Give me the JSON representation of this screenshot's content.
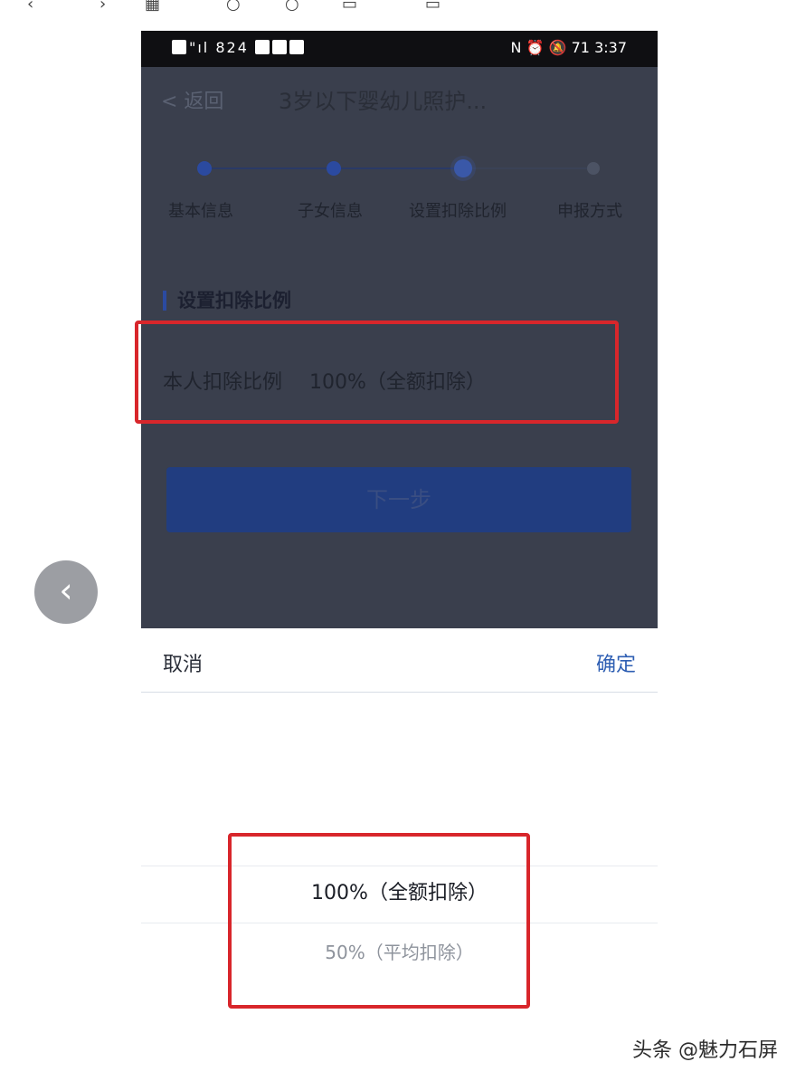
{
  "status_bar": {
    "left_text": "\"ıl 824",
    "time": "3:37",
    "battery": "71"
  },
  "header": {
    "back_label": "< 返回",
    "title": "3岁以下婴幼儿照护..."
  },
  "steps": [
    {
      "label": "基本信息",
      "state": "done"
    },
    {
      "label": "子女信息",
      "state": "done"
    },
    {
      "label": "设置扣除比例",
      "state": "current"
    },
    {
      "label": "申报方式",
      "state": "pending"
    }
  ],
  "section": {
    "title": "设置扣除比例"
  },
  "ratio": {
    "label": "本人扣除比例",
    "value": "100%（全额扣除）"
  },
  "next_button": "下一步",
  "picker": {
    "cancel": "取消",
    "confirm": "确定",
    "options": [
      "100%（全额扣除）",
      "50%（平均扣除）"
    ],
    "selected_index": 0
  },
  "watermark": "头条 @魅力石屏",
  "colors": {
    "highlight": "#d8262b",
    "accent": "#2f5fb3",
    "button": "#213d80"
  },
  "icons": {
    "float_back": "chevron-left-icon"
  }
}
